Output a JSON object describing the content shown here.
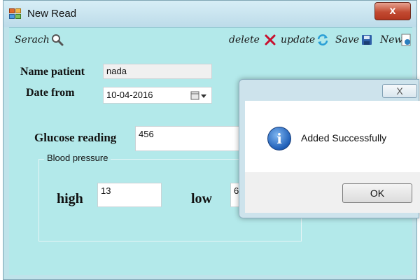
{
  "window": {
    "title": "New Read",
    "close_label": "x"
  },
  "toolbar": {
    "search_label": "Serach",
    "delete_label": "delete",
    "update_label": "update",
    "save_label": "Save",
    "new_label": "New"
  },
  "form": {
    "name_label": "Name patient",
    "name_value": "nada",
    "date_label": "Date from",
    "date_value": "10-04-2016",
    "glucose_label": "Glucose reading",
    "glucose_value": "456",
    "bp_group_label": "Blood pressure",
    "high_label": "high",
    "high_value": "13",
    "low_label": "low",
    "low_value": "6"
  },
  "dialog": {
    "close_label": "X",
    "message": "Added Successfully",
    "ok_label": "OK",
    "icon": "info-icon"
  },
  "colors": {
    "window_bg": "#b3e9ea",
    "delete_accent": "#c8102e",
    "update_accent": "#2a9fd6",
    "save_accent": "#2f5fa8"
  }
}
